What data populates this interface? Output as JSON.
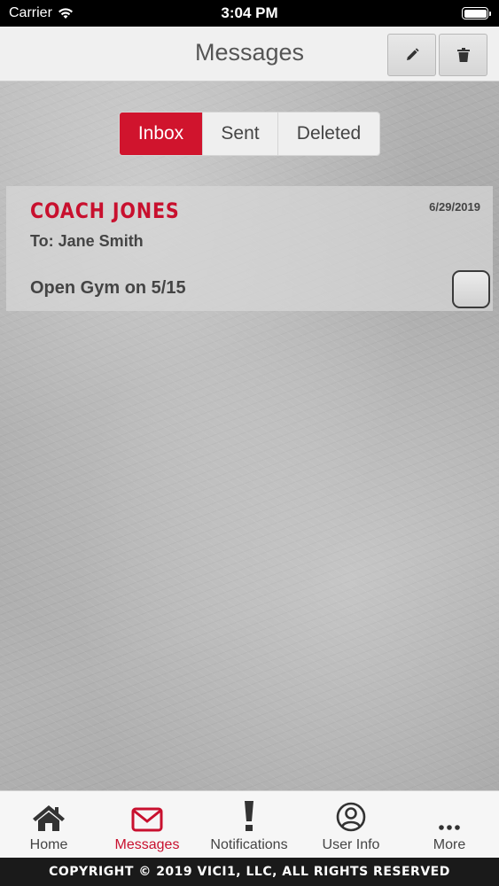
{
  "status_bar": {
    "carrier": "Carrier",
    "time": "3:04 PM"
  },
  "nav": {
    "title": "Messages",
    "compose_icon": "pencil-icon",
    "delete_icon": "trash-icon"
  },
  "segments": {
    "items": [
      {
        "label": "Inbox",
        "active": true
      },
      {
        "label": "Sent",
        "active": false
      },
      {
        "label": "Deleted",
        "active": false
      }
    ]
  },
  "messages": [
    {
      "sender": "COACH JONES",
      "date": "6/29/2019",
      "to": "To: Jane Smith",
      "subject": "Open Gym on 5/15",
      "checked": false
    }
  ],
  "tab_bar": {
    "items": [
      {
        "label": "Home",
        "icon": "home-icon",
        "active": false
      },
      {
        "label": "Messages",
        "icon": "envelope-icon",
        "active": true
      },
      {
        "label": "Notifications",
        "icon": "exclamation-icon",
        "active": false
      },
      {
        "label": "User Info",
        "icon": "user-icon",
        "active": false
      },
      {
        "label": "More",
        "icon": "more-dots-icon",
        "active": false
      }
    ]
  },
  "footer": {
    "text": "COPYRIGHT © 2019 VICI1, LLC, ALL RIGHTS RESERVED"
  },
  "colors": {
    "accent": "#c8102e",
    "segment_active": "#d0142d"
  }
}
